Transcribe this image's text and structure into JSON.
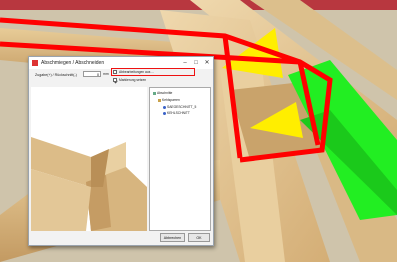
{
  "dialog": {
    "title": "Abschmiegen / Abschneiden",
    "controls": [
      "–",
      "□",
      "✕"
    ],
    "offset_label": "Zugabe(+) / Rückschnitt(-)",
    "offset_value": "0",
    "offset_unit": "mm",
    "checkbox1_label": "Abbearbeitungen aus ...",
    "checkbox2_label": "Markierung setzen",
    "checkbox1_checked": true,
    "checkbox2_checked": false,
    "tree": {
      "root": "Abschnitte",
      "group": "Kehlsparren",
      "item1": "SAEGESCHNITT_5",
      "item2": "KEHLSCHNITT"
    },
    "cancel_label": "Abbrechen",
    "ok_label": "OK"
  },
  "colors": {
    "highlight_red": "#ff0000",
    "highlight_green": "#20ee20",
    "highlight_yellow": "#ffee00",
    "wood": "#e5c899",
    "wood_dark": "#b88d55"
  }
}
